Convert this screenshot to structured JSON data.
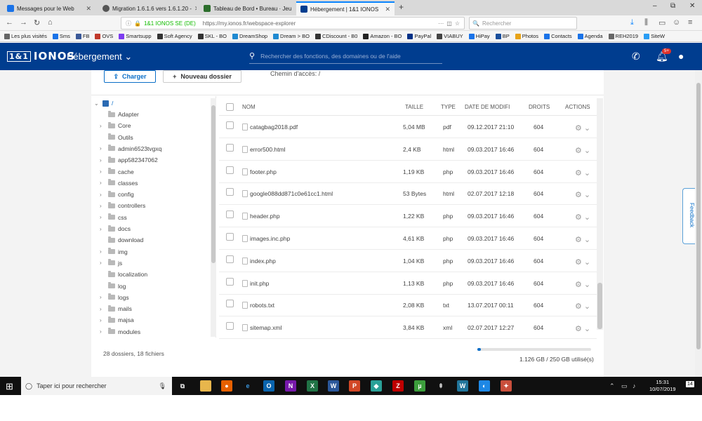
{
  "browser": {
    "tabs": [
      {
        "label": "Messages pour le Web",
        "color": "#1a73e8"
      },
      {
        "label": "Migration 1.6.1.6 vers 1.6.1.20 -",
        "color": "#555555"
      },
      {
        "label": "Tableau de Bord • Bureau · Jeu",
        "color": "#2c6e2c"
      },
      {
        "label": "Hébergement | 1&1 IONOS",
        "color": "#003d8f"
      }
    ],
    "new_tab": "+",
    "window_controls": [
      "–",
      "⧉",
      "✕"
    ],
    "url_owner": "1&1 IONOS SE (DE)",
    "url": "https://my.ionos.fr/webspace-explorer",
    "search_placeholder": "Rechercher",
    "bookmarks": [
      "Les plus visités",
      "Sms",
      "FB",
      "OVS",
      "Smartsupp",
      "Soft Agency",
      "SKL - BO",
      "DreamShop",
      "Dream > BO",
      "CDiscount - B0",
      "Amazon - BO",
      "PayPal",
      "VIABUY",
      "HiPay",
      "BP",
      "Photos",
      "Contacts",
      "Agenda",
      "REH2019",
      "SiteW"
    ]
  },
  "app": {
    "logo_box": "1&1",
    "logo": "IONOS",
    "menu": "Hébergement",
    "search_placeholder": "Rechercher des fonctions, des domaines ou de l'aide",
    "notif_badge": "5+"
  },
  "toolbar": {
    "upload_label": "Charger",
    "new_folder_label": "Nouveau dossier",
    "path_label": "Chemin d'accès: /"
  },
  "tree": {
    "root": "/",
    "items": [
      {
        "name": "Adapter",
        "expandable": false
      },
      {
        "name": "Core",
        "expandable": true
      },
      {
        "name": "Outils",
        "expandable": false
      },
      {
        "name": "admin6523tvgxq",
        "expandable": true
      },
      {
        "name": "app582347062",
        "expandable": true
      },
      {
        "name": "cache",
        "expandable": true
      },
      {
        "name": "classes",
        "expandable": true
      },
      {
        "name": "config",
        "expandable": true
      },
      {
        "name": "controllers",
        "expandable": true
      },
      {
        "name": "css",
        "expandable": true
      },
      {
        "name": "docs",
        "expandable": true
      },
      {
        "name": "download",
        "expandable": false
      },
      {
        "name": "img",
        "expandable": true
      },
      {
        "name": "js",
        "expandable": true
      },
      {
        "name": "localization",
        "expandable": false
      },
      {
        "name": "log",
        "expandable": false
      },
      {
        "name": "logs",
        "expandable": true
      },
      {
        "name": "mails",
        "expandable": true
      },
      {
        "name": "majsa",
        "expandable": true
      },
      {
        "name": "modules",
        "expandable": true
      }
    ]
  },
  "table": {
    "headers": {
      "name": "NOM",
      "size": "TAILLE",
      "type": "TYPE",
      "date": "DATE DE MODIFI",
      "rights": "DROITS",
      "actions": "ACTIONS"
    },
    "rows": [
      {
        "name": "catagbag2018.pdf",
        "size": "5,04 MB",
        "type": "pdf",
        "date": "09.12.2017 21:10",
        "rights": "604"
      },
      {
        "name": "error500.html",
        "size": "2,4 KB",
        "type": "html",
        "date": "09.03.2017 16:46",
        "rights": "604"
      },
      {
        "name": "footer.php",
        "size": "1,19 KB",
        "type": "php",
        "date": "09.03.2017 16:46",
        "rights": "604"
      },
      {
        "name": "google088dd871c0e61cc1.html",
        "size": "53 Bytes",
        "type": "html",
        "date": "02.07.2017 12:18",
        "rights": "604"
      },
      {
        "name": "header.php",
        "size": "1,22 KB",
        "type": "php",
        "date": "09.03.2017 16:46",
        "rights": "604"
      },
      {
        "name": "images.inc.php",
        "size": "4,61 KB",
        "type": "php",
        "date": "09.03.2017 16:46",
        "rights": "604"
      },
      {
        "name": "index.php",
        "size": "1,04 KB",
        "type": "php",
        "date": "09.03.2017 16:46",
        "rights": "604"
      },
      {
        "name": "init.php",
        "size": "1,13 KB",
        "type": "php",
        "date": "09.03.2017 16:46",
        "rights": "604"
      },
      {
        "name": "robots.txt",
        "size": "2,08 KB",
        "type": "txt",
        "date": "13.07.2017 00:11",
        "rights": "604"
      },
      {
        "name": "sitemap.xml",
        "size": "3,84 KB",
        "type": "xml",
        "date": "02.07.2017 12:27",
        "rights": "604"
      }
    ]
  },
  "footer": {
    "count": "28 dossiers, 18 fichiers",
    "storage_text": "1.126 GB / 250 GB utilisé(s)",
    "storage_used_fraction": 0.0045
  },
  "feedback_label": "Feedback",
  "taskbar": {
    "search_placeholder": "Taper ici pour rechercher",
    "time": "15:31",
    "date": "10/07/2019",
    "notification_count": "14"
  }
}
